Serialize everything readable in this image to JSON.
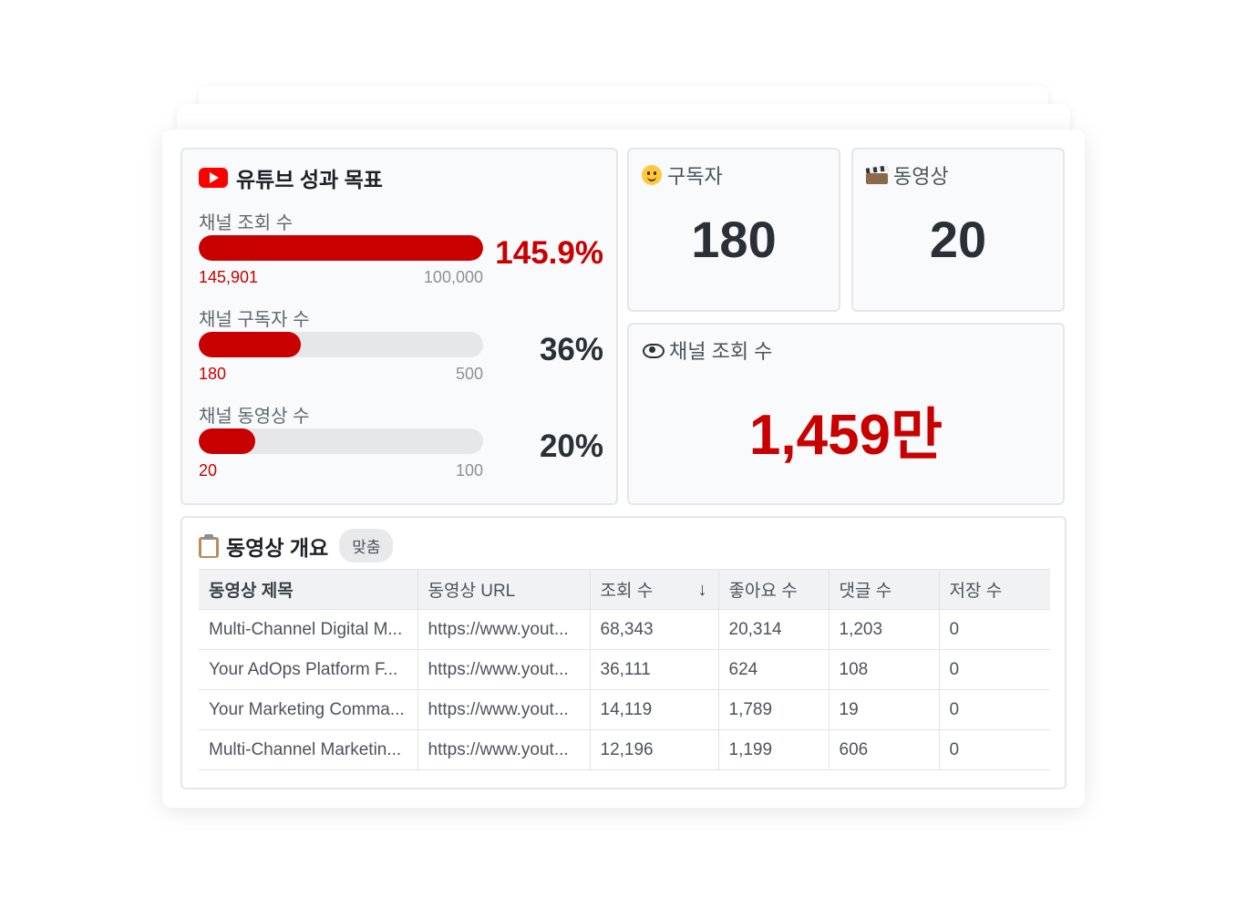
{
  "goals": {
    "title": "유튜브 성과 목표",
    "metrics": [
      {
        "label": "채널 조회 수",
        "current": "145,901",
        "target": "100,000",
        "percent_text": "145.9%",
        "progress": 1.0
      },
      {
        "label": "채널 구독자 수",
        "current": "180",
        "target": "500",
        "percent_text": "36%",
        "progress": 0.36
      },
      {
        "label": "채널 동영상 수",
        "current": "20",
        "target": "100",
        "percent_text": "20%",
        "progress": 0.2
      }
    ]
  },
  "stats": {
    "subscribers": {
      "label": "구독자",
      "value": "180",
      "icon": "smiling-face-icon"
    },
    "videos": {
      "label": "동영상",
      "value": "20",
      "icon": "film-icon"
    },
    "views": {
      "label": "채널 조회 수",
      "value": "1,459만",
      "icon": "eye-icon"
    }
  },
  "overview": {
    "title": "동영상 개요",
    "tag": "맞춤",
    "columns": [
      "동영상 제목",
      "동영상 URL",
      "조회 수",
      "좋아요 수",
      "댓글 수",
      "저장 수"
    ],
    "rows": [
      [
        "Multi-Channel Digital M...",
        "https://www.yout...",
        "68,343",
        "20,314",
        "1,203",
        "0"
      ],
      [
        "Your AdOps Platform F...",
        "https://www.yout...",
        "36,111",
        "624",
        "108",
        "0"
      ],
      [
        "Your Marketing Comma...",
        "https://www.yout...",
        "14,119",
        "1,789",
        "19",
        "0"
      ],
      [
        "Multi-Channel Marketin...",
        "https://www.yout...",
        "12,196",
        "1,199",
        "606",
        "0"
      ]
    ]
  },
  "colors": {
    "accent": "#c90000",
    "youtube": "#ff0000",
    "track": "#e6e7e9"
  }
}
